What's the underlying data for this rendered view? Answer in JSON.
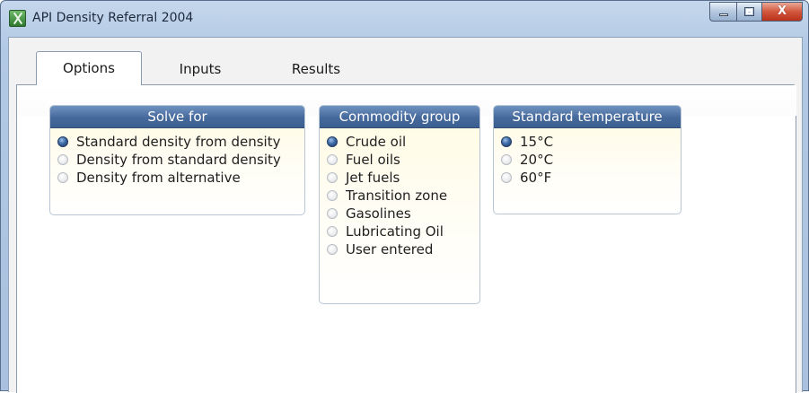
{
  "window": {
    "title": "API Density Referral 2004",
    "buttons": {
      "minimize": "minimize",
      "maximize": "maximize",
      "close": "X"
    }
  },
  "tabs": [
    {
      "label": "Options",
      "active": true
    },
    {
      "label": "Inputs",
      "active": false
    },
    {
      "label": "Results",
      "active": false
    }
  ],
  "solve_for": {
    "title": "Solve for",
    "options": [
      {
        "label": "Standard density from density",
        "selected": true
      },
      {
        "label": "Density from standard density",
        "selected": false
      },
      {
        "label": "Density from alternative",
        "selected": false
      }
    ]
  },
  "commodity_group": {
    "title": "Commodity group",
    "options": [
      {
        "label": "Crude oil",
        "selected": true
      },
      {
        "label": "Fuel oils",
        "selected": false
      },
      {
        "label": "Jet fuels",
        "selected": false
      },
      {
        "label": "Transition zone",
        "selected": false
      },
      {
        "label": "Gasolines",
        "selected": false
      },
      {
        "label": "Lubricating Oil",
        "selected": false
      },
      {
        "label": "User entered",
        "selected": false
      }
    ]
  },
  "standard_temperature": {
    "title": "Standard temperature",
    "options": [
      {
        "label": "15°C",
        "selected": true
      },
      {
        "label": "20°C",
        "selected": false
      },
      {
        "label": "60°F",
        "selected": false
      }
    ]
  },
  "colors": {
    "group_header": "#46699b",
    "group_body": "#fffbe2",
    "radio_checked": "#3e6aa8",
    "close_button": "#d2573c"
  },
  "icons": {
    "app": "excel-x-icon",
    "close": "close-icon",
    "minimize": "minimize-icon",
    "maximize": "maximize-icon"
  }
}
